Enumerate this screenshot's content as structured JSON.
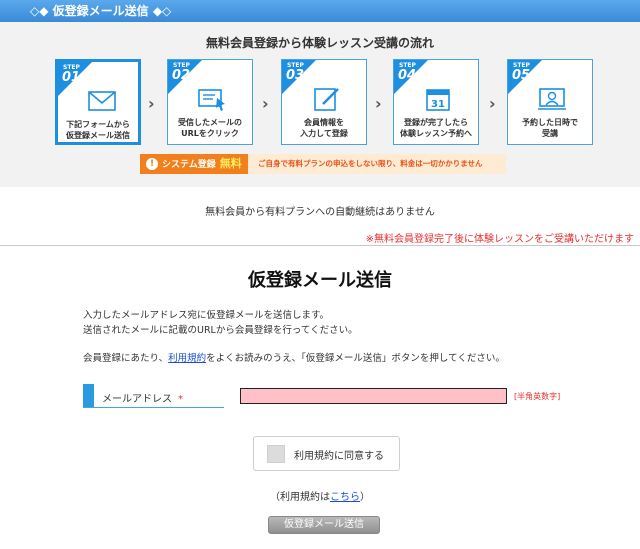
{
  "header": {
    "title": "◇◆ 仮登録メール送信 ◆◇"
  },
  "flow": {
    "title": "無料会員登録から体験レッスン受講の流れ",
    "step_label": "STEP",
    "steps": [
      {
        "num": "01",
        "icon": "mail-icon",
        "line1": "下記フォームから",
        "line2": "仮登録メール送信"
      },
      {
        "num": "02",
        "icon": "click-mail-icon",
        "line1": "受信したメールの",
        "line2": "URLをクリック"
      },
      {
        "num": "03",
        "icon": "edit-icon",
        "line1": "会員情報を",
        "line2": "入力して登録"
      },
      {
        "num": "04",
        "icon": "calendar-icon",
        "line1": "登録が完了したら",
        "line2": "体験レッスン予約へ"
      },
      {
        "num": "05",
        "icon": "video-lesson-icon",
        "line1": "予約した日時で",
        "line2": "受講"
      }
    ],
    "calendar_day": "31",
    "note": {
      "tag": "システム登録",
      "free": "無料",
      "text": "ご自身で有料プランの申込をしない限り、料金は一切かかりません"
    }
  },
  "auto_note": "無料会員から有料プランへの自動継続はありません",
  "red_note": "※無料会員登録完了後に体験レッスンをご受講いただけます",
  "form": {
    "title": "仮登録メール送信",
    "intro1": "入力したメールアドレス宛に仮登録メールを送信します。",
    "intro2": "送信されたメールに記載のURLから会員登録を行ってください。",
    "consent_prefix": "会員登録にあたり、",
    "consent_link": "利用規約",
    "consent_suffix": "をよくお読みのうえ、「仮登録メール送信」ボタンを押してください。",
    "email_label": "メールアドレス",
    "required_mark": "*",
    "email_value": "",
    "email_hint": "[半角英数字]",
    "agree_label": "利用規約に同意する",
    "terms_prefix": "（利用規約は",
    "terms_link": "こちら",
    "terms_suffix": "）",
    "submit_label": "仮登録メール送信"
  },
  "colors": {
    "header": "#3b8ad8",
    "step_blue": "#1c8fe0",
    "orange": "#f07f1c",
    "red": "#e83030",
    "input_bg": "#ffc0c8"
  }
}
